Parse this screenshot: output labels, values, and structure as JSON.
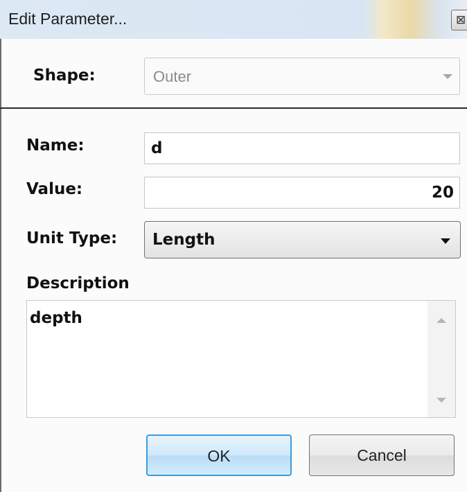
{
  "window": {
    "title": "Edit Parameter...",
    "close_icon": "close-icon",
    "close_glyph": "⊠"
  },
  "shape": {
    "label": "Shape:",
    "value": "Outer",
    "enabled": false
  },
  "name": {
    "label": "Name:",
    "value": "d"
  },
  "value": {
    "label": "Value:",
    "value": "20"
  },
  "unit_type": {
    "label": "Unit Type:",
    "value": "Length"
  },
  "description": {
    "label": "Description",
    "value": "depth"
  },
  "buttons": {
    "ok": "OK",
    "cancel": "Cancel"
  },
  "colors": {
    "ok_border": "#3c9be0",
    "separator": "#2a2a2a"
  }
}
